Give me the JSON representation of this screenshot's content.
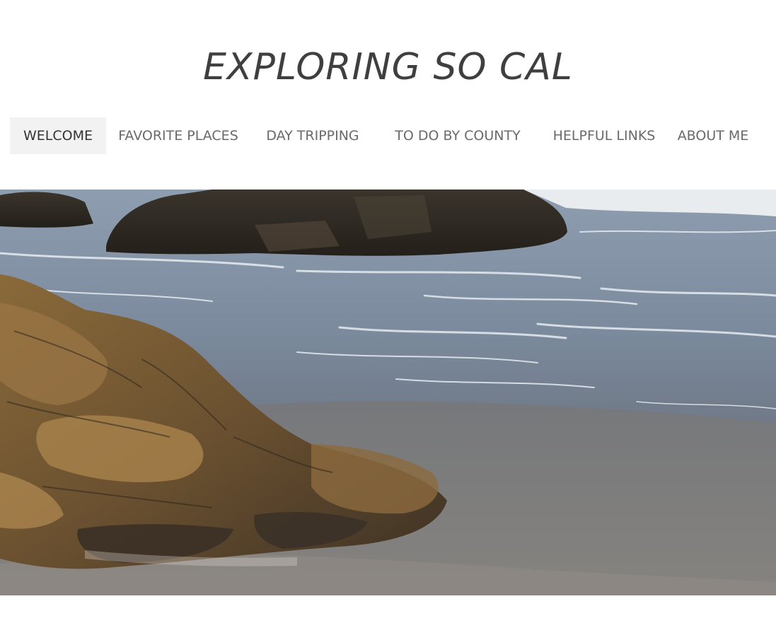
{
  "site": {
    "title": "EXPLORING SO CAL"
  },
  "nav": {
    "items": [
      {
        "label": "WELCOME",
        "active": true
      },
      {
        "label": "FAVORITE PLACES",
        "active": false
      },
      {
        "label": "DAY TRIPPING",
        "active": false
      },
      {
        "label": "TO DO BY COUNTY",
        "active": false
      },
      {
        "label": "HELPFUL LINKS",
        "active": false
      },
      {
        "label": "ABOUT ME",
        "active": false
      }
    ]
  },
  "hero": {
    "subject": "rocky beach shoreline with ocean waves"
  },
  "colors": {
    "title": "#3f3f3f",
    "nav_text": "#6a6a6a",
    "nav_active_text": "#333333",
    "nav_active_bg": "#f2f2f2"
  }
}
